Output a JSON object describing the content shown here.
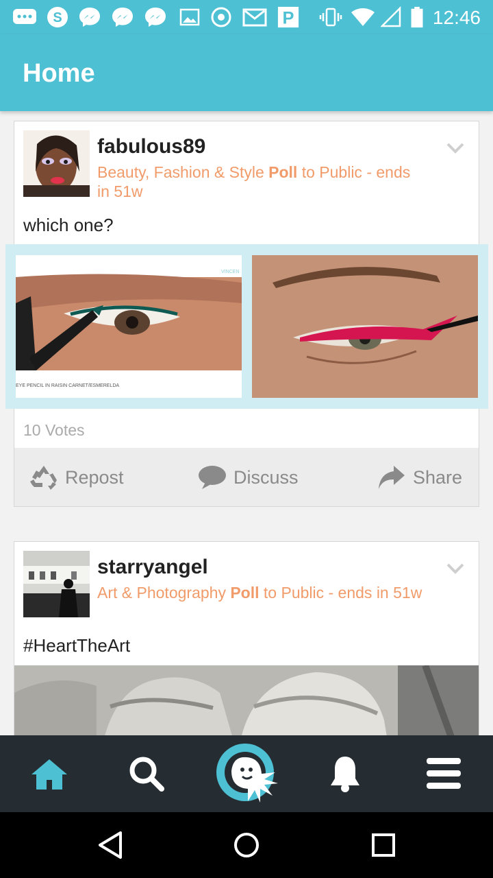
{
  "status_bar": {
    "time": "12:46",
    "icons": [
      "more-chat-icon",
      "skype-icon",
      "messenger-icon",
      "messenger-icon",
      "messenger-icon",
      "image-icon",
      "app-icon",
      "gmail-icon",
      "pinterest-p-icon",
      "vibrate-icon",
      "wifi-icon",
      "signal-icon",
      "battery-icon"
    ]
  },
  "app_bar": {
    "title": "Home"
  },
  "posts": [
    {
      "username": "fabulous89",
      "category": "Beauty, Fashion & Style",
      "type_label": "Poll",
      "audience": "to Public -  ends in 51w",
      "text": "which one?",
      "image_caption": "EYE PENCIL IN RAISIN CARNET/ESMERELDA",
      "image_brand": "VINCEN",
      "votes": "10 Votes",
      "actions": {
        "repost": "Repost",
        "discuss": "Discuss",
        "share": "Share"
      }
    },
    {
      "username": "starryangel",
      "category": "Art & Photography",
      "type_label": "Poll",
      "audience": "to Public -  ends in 51w",
      "text": "#HeartTheArt"
    }
  ],
  "colors": {
    "accent": "#4ec0d3",
    "meta_orange": "#f19b6a",
    "nav_bg": "#252d33",
    "nav_active": "#4ec0d3"
  },
  "bottom_nav": [
    "home-icon",
    "search-icon",
    "octopus-logo-icon",
    "bell-icon",
    "menu-icon"
  ],
  "system_nav": [
    "back-icon",
    "home-circle-icon",
    "recents-icon"
  ]
}
